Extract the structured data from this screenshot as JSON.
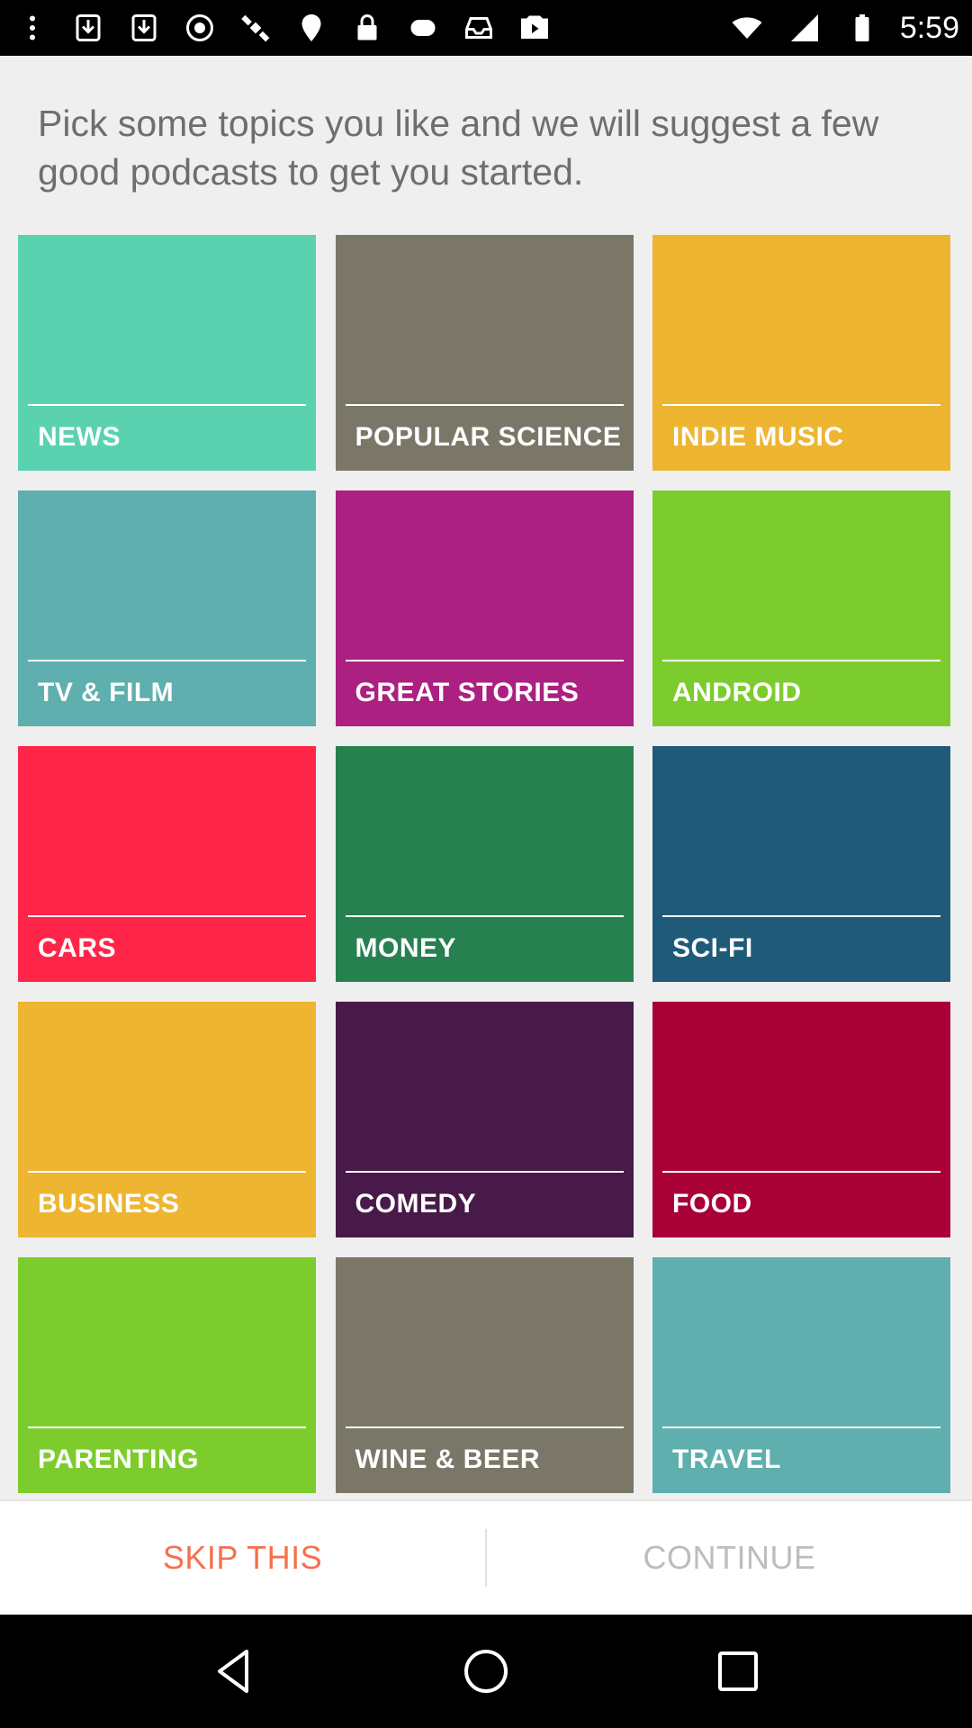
{
  "status_bar": {
    "time": "5:59",
    "icons": [
      "dots-icon",
      "download-icon",
      "download-icon",
      "sync-icon",
      "satellite-icon",
      "fake-gps-icon",
      "lock-icon",
      "game-icon",
      "inbox-icon",
      "play-icon",
      "wifi-icon",
      "signal-icon",
      "battery-icon"
    ]
  },
  "intro_text": "Pick some topics you like and we will suggest a few good podcasts to get you started.",
  "topics": [
    {
      "label": "NEWS",
      "color": "#5ad2b0"
    },
    {
      "label": "POPULAR SCIENCE",
      "color": "#7a7769"
    },
    {
      "label": "INDIE MUSIC",
      "color": "#eeb531"
    },
    {
      "label": "TV & FILM",
      "color": "#5eafae"
    },
    {
      "label": "GREAT STORIES",
      "color": "#ab2081"
    },
    {
      "label": "ANDROID",
      "color": "#7dcc2e"
    },
    {
      "label": "CARS",
      "color": "#ff2549"
    },
    {
      "label": "MONEY",
      "color": "#268050"
    },
    {
      "label": "SCI-FI",
      "color": "#1f5a78"
    },
    {
      "label": "BUSINESS",
      "color": "#eeb531"
    },
    {
      "label": "COMEDY",
      "color": "#471a49"
    },
    {
      "label": "FOOD",
      "color": "#a80037"
    },
    {
      "label": "PARENTING",
      "color": "#7dcc2e"
    },
    {
      "label": "WINE & BEER",
      "color": "#7a7769"
    },
    {
      "label": "TRAVEL",
      "color": "#5eafae"
    }
  ],
  "actions": {
    "skip_label": "SKIP THIS",
    "continue_label": "CONTINUE"
  },
  "colors": {
    "accent": "#f4714e",
    "disabled": "#bdbdbd",
    "background": "#efefef"
  }
}
